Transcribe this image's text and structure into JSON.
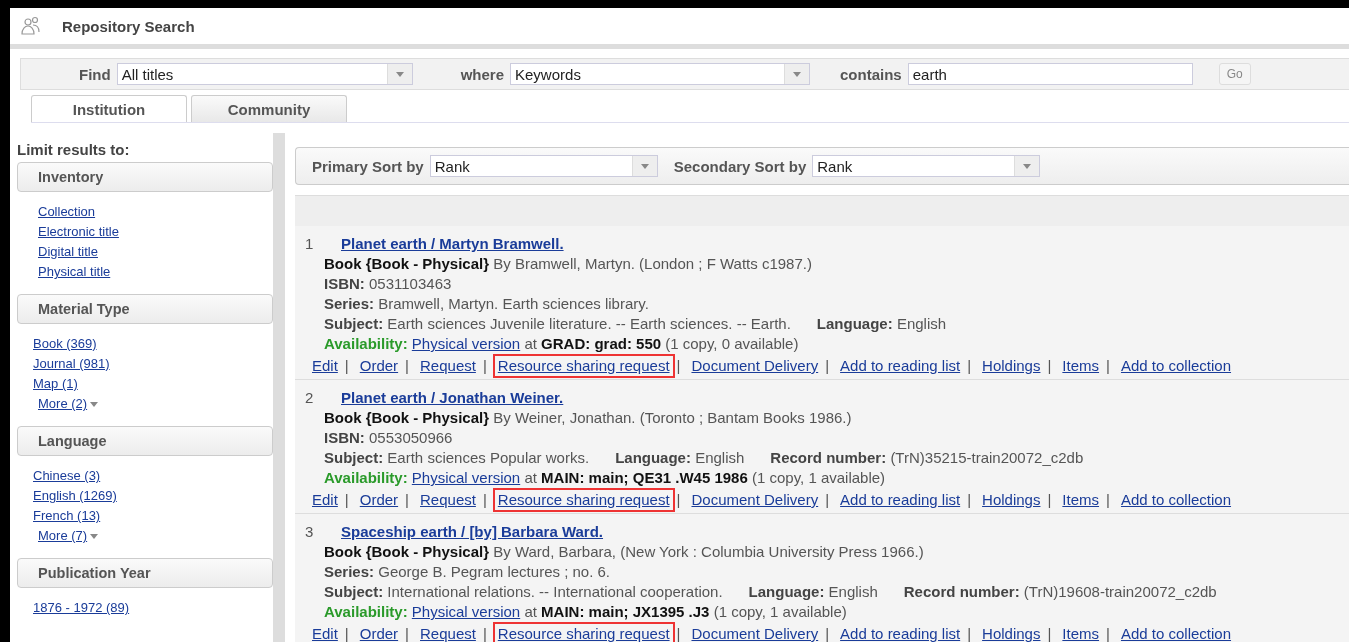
{
  "header": {
    "title": "Repository Search"
  },
  "find_bar": {
    "find_label": "Find",
    "find_value": "All titles",
    "where_label": "where",
    "where_value": "Keywords",
    "contains_label": "contains",
    "contains_value": "earth",
    "go_button": "Go"
  },
  "tabs": [
    {
      "label": "Institution",
      "selected": true
    },
    {
      "label": "Community",
      "selected": false
    }
  ],
  "sidebar": {
    "heading": "Limit results to:",
    "facets": [
      {
        "title": "Inventory",
        "items": [
          {
            "label": "Collection",
            "kind": "link"
          },
          {
            "label": "Electronic title",
            "kind": "link"
          },
          {
            "label": "Digital title",
            "kind": "link"
          },
          {
            "label": "Physical title",
            "kind": "link"
          }
        ]
      },
      {
        "title": "Material Type",
        "items": [
          {
            "label": "Book (369)",
            "kind": "count"
          },
          {
            "label": "Journal (981)",
            "kind": "count"
          },
          {
            "label": "Map (1)",
            "kind": "count"
          },
          {
            "label": "More (2)",
            "kind": "more"
          }
        ]
      },
      {
        "title": "Language",
        "items": [
          {
            "label": "Chinese (3)",
            "kind": "count"
          },
          {
            "label": "English (1269)",
            "kind": "count"
          },
          {
            "label": "French (13)",
            "kind": "count"
          },
          {
            "label": "More (7)",
            "kind": "more"
          }
        ]
      },
      {
        "title": "Publication Year",
        "items": [
          {
            "label": "1876 - 1972 (89)",
            "kind": "count"
          }
        ]
      }
    ]
  },
  "sort_bar": {
    "primary_label": "Primary Sort by",
    "primary_value": "Rank",
    "secondary_label": "Secondary Sort by",
    "secondary_value": "Rank"
  },
  "action_separator": "|",
  "results": [
    {
      "number": "1",
      "title": "Planet earth / Martyn Bramwell.",
      "format": "Book {Book - Physical}",
      "by": "By Bramwell, Martyn. (London ; F Watts c1987.)",
      "details": [
        [
          {
            "label": "ISBN:",
            "value": "0531103463"
          }
        ],
        [
          {
            "label": "Series:",
            "value": "Bramwell, Martyn. Earth sciences library."
          }
        ],
        [
          {
            "label": "Subject:",
            "value": "Earth sciences Juvenile literature. -- Earth sciences. -- Earth."
          },
          {
            "label": "Language:",
            "value": "English"
          }
        ]
      ],
      "availability": {
        "label": "Availability:",
        "link": "Physical version",
        "at": "at",
        "location": "GRAD: grad: 550",
        "note": "(1 copy, 0 available)"
      },
      "actions": [
        {
          "label": "Edit",
          "highlighted": false
        },
        {
          "label": "Order",
          "highlighted": false
        },
        {
          "label": "Request",
          "highlighted": false
        },
        {
          "label": "Resource sharing request",
          "highlighted": true
        },
        {
          "label": "Document Delivery",
          "highlighted": false
        },
        {
          "label": "Add to reading list",
          "highlighted": false
        },
        {
          "label": "Holdings",
          "highlighted": false
        },
        {
          "label": "Items",
          "highlighted": false
        },
        {
          "label": "Add to collection",
          "highlighted": false
        }
      ]
    },
    {
      "number": "2",
      "title": "Planet earth / Jonathan Weiner.",
      "format": "Book {Book - Physical}",
      "by": "By Weiner, Jonathan. (Toronto ; Bantam Books 1986.)",
      "details": [
        [
          {
            "label": "ISBN:",
            "value": "0553050966"
          }
        ],
        [
          {
            "label": "Subject:",
            "value": "Earth sciences Popular works."
          },
          {
            "label": "Language:",
            "value": "English"
          },
          {
            "label": "Record number:",
            "value": "(TrN)35215-train20072_c2db"
          }
        ]
      ],
      "availability": {
        "label": "Availability:",
        "link": "Physical version",
        "at": "at",
        "location": "MAIN: main; QE31 .W45 1986",
        "note": "(1 copy, 1 available)"
      },
      "actions": [
        {
          "label": "Edit",
          "highlighted": false
        },
        {
          "label": "Order",
          "highlighted": false
        },
        {
          "label": "Request",
          "highlighted": false
        },
        {
          "label": "Resource sharing request",
          "highlighted": true
        },
        {
          "label": "Document Delivery",
          "highlighted": false
        },
        {
          "label": "Add to reading list",
          "highlighted": false
        },
        {
          "label": "Holdings",
          "highlighted": false
        },
        {
          "label": "Items",
          "highlighted": false
        },
        {
          "label": "Add to collection",
          "highlighted": false
        }
      ]
    },
    {
      "number": "3",
      "title": "Spaceship earth / [by] Barbara Ward.",
      "format": "Book {Book - Physical}",
      "by": "By Ward, Barbara, (New York : Columbia University Press 1966.)",
      "details": [
        [
          {
            "label": "Series:",
            "value": "George B. Pegram lectures ; no. 6."
          }
        ],
        [
          {
            "label": "Subject:",
            "value": "International relations. -- International cooperation."
          },
          {
            "label": "Language:",
            "value": "English"
          },
          {
            "label": "Record number:",
            "value": "(TrN)19608-train20072_c2db"
          }
        ]
      ],
      "availability": {
        "label": "Availability:",
        "link": "Physical version",
        "at": "at",
        "location": "MAIN: main; JX1395 .J3",
        "note": "(1 copy, 1 available)"
      },
      "actions": [
        {
          "label": "Edit",
          "highlighted": false
        },
        {
          "label": "Order",
          "highlighted": false
        },
        {
          "label": "Request",
          "highlighted": false
        },
        {
          "label": "Resource sharing request",
          "highlighted": true
        },
        {
          "label": "Document Delivery",
          "highlighted": false
        },
        {
          "label": "Add to reading list",
          "highlighted": false
        },
        {
          "label": "Holdings",
          "highlighted": false
        },
        {
          "label": "Items",
          "highlighted": false
        },
        {
          "label": "Add to collection",
          "highlighted": false
        }
      ]
    }
  ]
}
